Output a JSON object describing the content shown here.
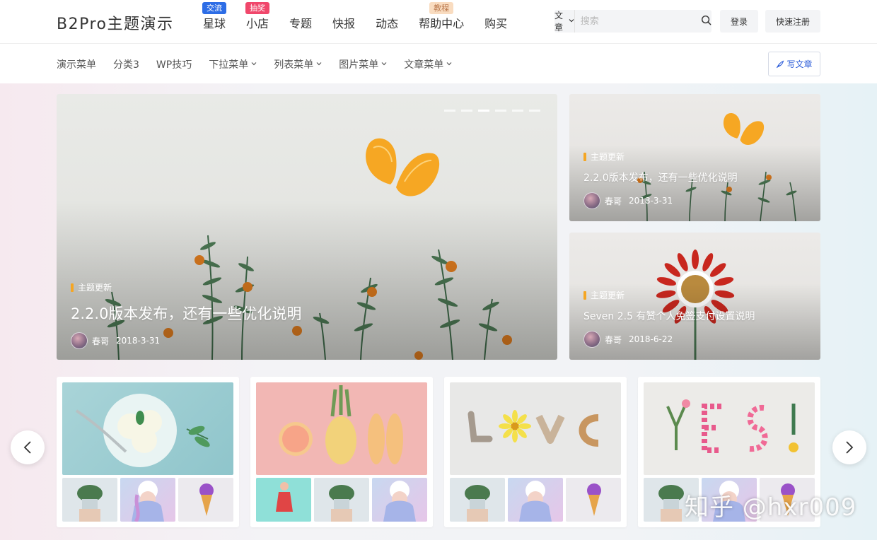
{
  "header": {
    "logo": "B2Pro主题演示",
    "nav": [
      {
        "label": "星球",
        "badge": "交流",
        "badge_bg": "#2d6de6",
        "badge_color": "#ffffff"
      },
      {
        "label": "小店",
        "badge": "抽奖",
        "badge_bg": "#f0476b",
        "badge_color": "#ffffff"
      },
      {
        "label": "专题"
      },
      {
        "label": "快报"
      },
      {
        "label": "动态"
      },
      {
        "label": "帮助中心",
        "badge": "教程",
        "badge_bg": "#f9dcc0",
        "badge_color": "#b9764a"
      },
      {
        "label": "购买"
      }
    ],
    "search": {
      "type_label": "文章",
      "placeholder": "搜索"
    },
    "login_label": "登录",
    "register_label": "快速注册"
  },
  "subnav": {
    "items": [
      {
        "label": "演示菜单",
        "dropdown": false
      },
      {
        "label": "分类3",
        "dropdown": false
      },
      {
        "label": "WP技巧",
        "dropdown": false
      },
      {
        "label": "下拉菜单",
        "dropdown": true
      },
      {
        "label": "列表菜单",
        "dropdown": true
      },
      {
        "label": "图片菜单",
        "dropdown": true
      },
      {
        "label": "文章菜单",
        "dropdown": true
      }
    ],
    "write_label": "写文章"
  },
  "hero": {
    "category": "主题更新",
    "title": "2.2.0版本发布，还有一些优化说明",
    "author": "春哥",
    "date": "2018-3-31",
    "slides": 6,
    "active_slide": 3
  },
  "side_posts": [
    {
      "category": "主题更新",
      "title": "2.2.0版本发布，还有一些优化说明",
      "author": "春哥",
      "date": "2018-3-31"
    },
    {
      "category": "主题更新",
      "title": "Seven 2.5 有赞个人免签支付设置说明",
      "author": "春哥",
      "date": "2018-6-22"
    }
  ],
  "gallery_cards": [
    {
      "main": "ice-cream",
      "thumbs": [
        "plant-pot",
        "portrait",
        "ice-cream-cone"
      ]
    },
    {
      "main": "fruit-shoes",
      "thumbs": [
        "dancer",
        "plant-pot",
        "portrait"
      ]
    },
    {
      "main": "love-letters",
      "thumbs": [
        "plant-pot",
        "portrait",
        "ice-cream-cone"
      ]
    },
    {
      "main": "yes-flowers",
      "thumbs": [
        "plant-pot",
        "portrait",
        "ice-cream-cone"
      ]
    }
  ],
  "watermark": "知乎 @hxr009",
  "colors": {
    "accent": "#2f5fd9",
    "category_bar": "#f5a623"
  }
}
